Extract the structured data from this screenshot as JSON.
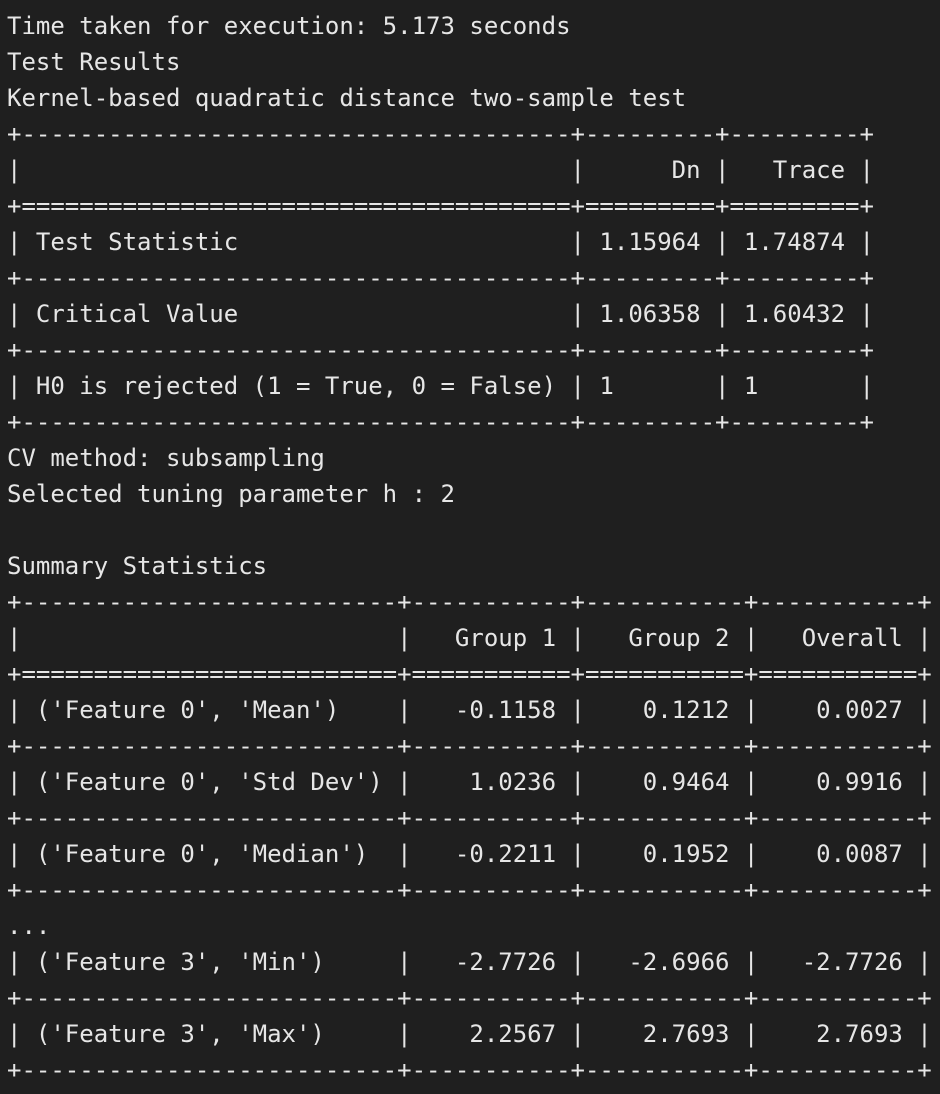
{
  "output": {
    "execution_time": "Time taken for execution: 5.173 seconds",
    "section_title": "Test Results",
    "test_name": "Kernel-based quadratic distance two-sample test",
    "results_table": [
      "+--------------------------------------+---------+---------+",
      "|                                      |      Dn |   Trace |",
      "+======================================+=========+=========+",
      "| Test Statistic                       | 1.15964 | 1.74874 |",
      "+--------------------------------------+---------+---------+",
      "| Critical Value                       | 1.06358 | 1.60432 |",
      "+--------------------------------------+---------+---------+",
      "| H0 is rejected (1 = True, 0 = False) | 1       | 1       |",
      "+--------------------------------------+---------+---------+"
    ],
    "cv_method": "CV method: subsampling",
    "tuning_param": "Selected tuning parameter h : 2",
    "summary_title": "Summary Statistics",
    "summary_table": [
      "+--------------------------+-----------+-----------+-----------+",
      "|                          |   Group 1 |   Group 2 |   Overall |",
      "+==========================+===========+===========+===========+",
      "| ('Feature 0', 'Mean')    |   -0.1158 |    0.1212 |    0.0027 |",
      "+--------------------------+-----------+-----------+-----------+",
      "| ('Feature 0', 'Std Dev') |    1.0236 |    0.9464 |    0.9916 |",
      "+--------------------------+-----------+-----------+-----------+",
      "| ('Feature 0', 'Median')  |   -0.2211 |    0.1952 |    0.0087 |",
      "+--------------------------+-----------+-----------+-----------+"
    ],
    "ellipsis": "...",
    "summary_table_tail": [
      "| ('Feature 3', 'Min')     |   -2.7726 |   -2.6966 |   -2.7726 |",
      "+--------------------------+-----------+-----------+-----------+",
      "| ('Feature 3', 'Max')     |    2.2567 |    2.7693 |    2.7693 |",
      "+--------------------------+-----------+-----------+-----------+"
    ]
  }
}
